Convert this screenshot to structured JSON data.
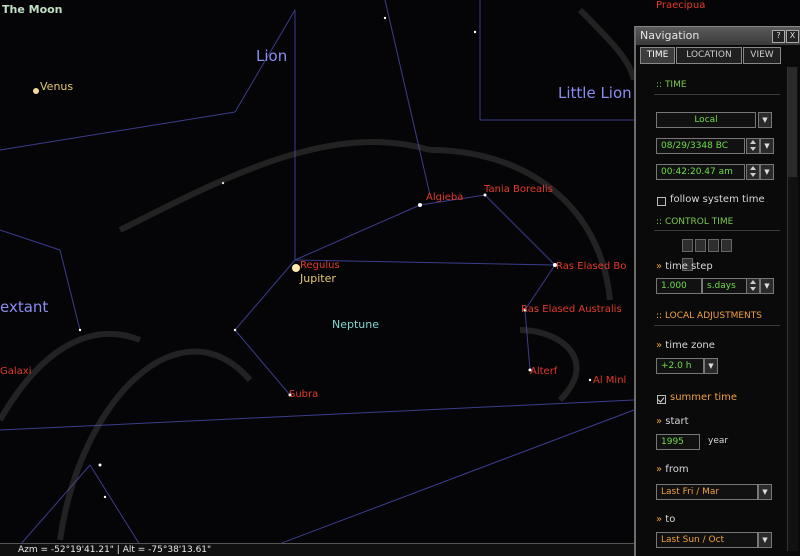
{
  "sky": {
    "top_label": "The Moon",
    "constellations": [
      "Lion",
      "Little Lion",
      "extant"
    ],
    "planets": [
      "Venus",
      "Jupiter",
      "Neptune"
    ],
    "stars": [
      "Tania Borealis",
      "Algieba",
      "Regulus",
      "Ras Elased Bo",
      "Ras Elased Australis",
      "Subra",
      "Alterf",
      "Al Minl",
      "Galaxi",
      "Praecipua"
    ]
  },
  "status_bar": {
    "text": "Azm = -52°19'41.21\" | Alt = -75°38'13.61\""
  },
  "navigation": {
    "title": "Navigation",
    "window_buttons": [
      "?",
      "X"
    ],
    "tabs": [
      "TIME",
      "LOCATION",
      "VIEW"
    ],
    "time_section": "TIME",
    "timezone_mode": "Local",
    "date_value": "08/29/3348 BC",
    "time_value": "00:42:20.47 am",
    "follow_system_time": "follow system time",
    "control_time_section": "CONTROL TIME",
    "time_step_label": "time step",
    "time_step_value": "1.000",
    "time_step_unit": "s.days",
    "local_adjustments_section": "LOCAL ADJUSTMENTS",
    "time_zone_label": "time zone",
    "time_zone_value": "+2.0 h",
    "summer_time": "summer time",
    "start_label": "start",
    "start_year": "1995",
    "year_label": "year",
    "from_label": "from",
    "from_value": "Last  Fri / Mar",
    "to_label": "to",
    "to_value": "Last  Sun / Oct"
  },
  "colors": {
    "constellation": "#8a8cf0",
    "star_label": "#e23a2a",
    "planet_label": "#e7c873",
    "section_green": "#7cc84a",
    "orange_label": "#f0a040"
  }
}
